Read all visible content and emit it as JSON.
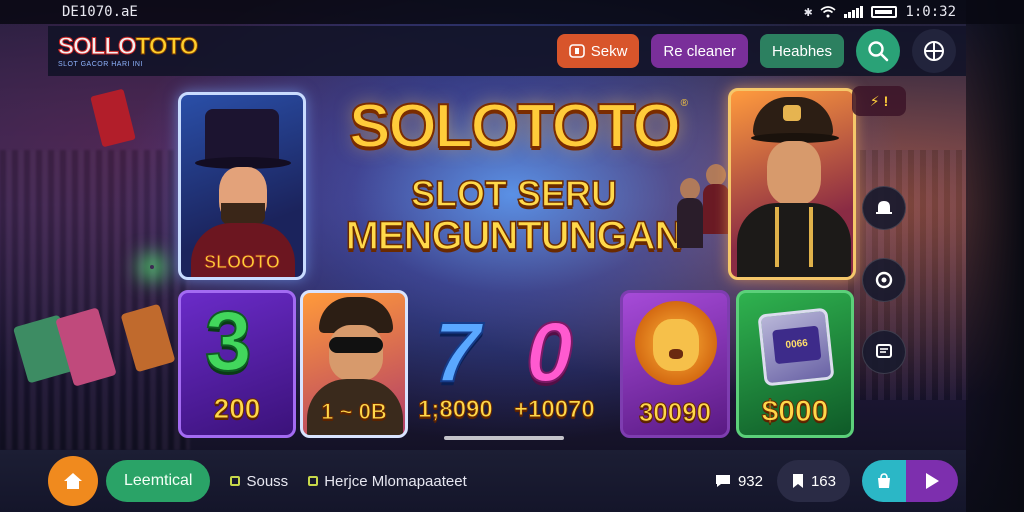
{
  "status_bar": {
    "carrier": "DE1070.aE",
    "time": "1:0:32"
  },
  "brand": {
    "logo_part1": "SOLLO",
    "logo_part2": "TOTO",
    "logo_tagline": "SLOT GACOR HARI INI"
  },
  "nav": {
    "login_label": "Sekw",
    "register_label": "Re cleaner",
    "heaches_label": "Heabhes",
    "search_icon": "search-icon",
    "globe_icon": "globe-icon"
  },
  "hero": {
    "title": "SOLOTOTO",
    "subtitle_line1": "SLOT SERU",
    "subtitle_line2": "MENGUNTUNGAN",
    "left_card_caption": "SLOOTO",
    "corner_badge_value": "!",
    "registered_mark": "®"
  },
  "tiles": [
    {
      "label": "200",
      "symbol": "3"
    },
    {
      "label": "1 ~ 0B"
    },
    {
      "label_left": "1;8090",
      "label_right": "+10070",
      "symbol_left": "7",
      "symbol_right": "0"
    },
    {
      "label": "30090"
    },
    {
      "label": "$000",
      "screen_text": "0066"
    }
  ],
  "side_buttons": [
    "bell-icon",
    "settings-icon",
    "chat-bubble-icon"
  ],
  "bottom_bar": {
    "home_icon": "home-icon",
    "primary_label": "Leemtical",
    "link1_label": "Souss",
    "link2_label": "Herjce Mlomapaateet",
    "chat_count": "932",
    "bookmark_count": "163",
    "play_icon": "play-icon"
  },
  "colors": {
    "accent_orange": "#d8552b",
    "accent_purple": "#7a2f9a",
    "accent_green": "#2c8060",
    "title_gold": "#ffcc3a"
  }
}
